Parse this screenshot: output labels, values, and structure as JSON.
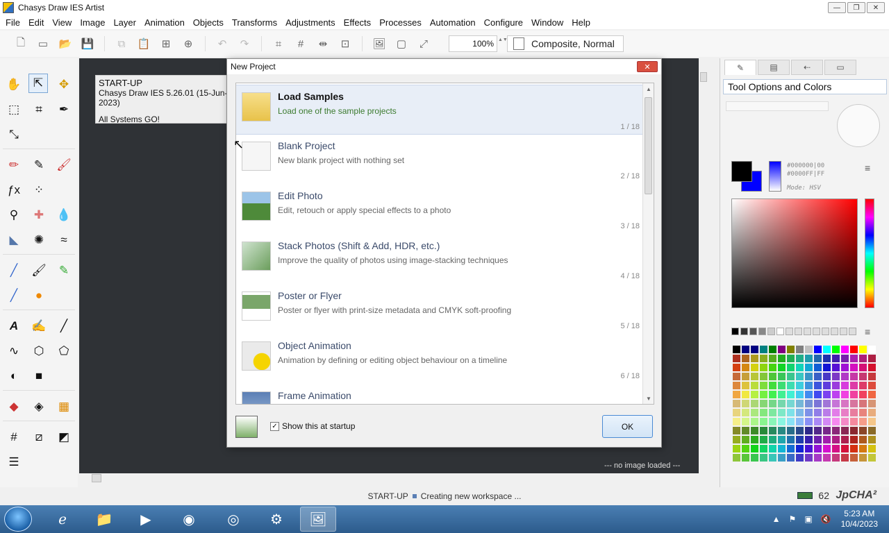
{
  "window": {
    "title": "Chasys Draw IES Artist",
    "min": "—",
    "max": "❐",
    "close": "✕"
  },
  "menu": [
    "File",
    "Edit",
    "View",
    "Image",
    "Layer",
    "Animation",
    "Objects",
    "Transforms",
    "Adjustments",
    "Effects",
    "Processes",
    "Automation",
    "Configure",
    "Window",
    "Help"
  ],
  "toolbar": {
    "zoom": "100%",
    "zoom_spin": "▲▼",
    "composite": "Composite, Normal"
  },
  "startup_card": {
    "line1": "START-UP",
    "line2": "Chasys Draw IES 5.26.01 (15-Jun-2023)",
    "line3": "All Systems GO!"
  },
  "workspace": {
    "status": "--- no image loaded ---"
  },
  "right_panel": {
    "title": "Tool Options and Colors",
    "hex1": "#000000|00",
    "hex2": "#0000FF|FF",
    "mode": "Mode: HSV",
    "menu_icon": "≡",
    "palette_colors": [
      "#000000",
      "#000080",
      "#000080",
      "#008080",
      "#008000",
      "#800080",
      "#808000",
      "#808080",
      "#c0c0c0",
      "#0000ff",
      "#00ffff",
      "#00ff00",
      "#ff00ff",
      "#ff0000",
      "#ffff00",
      "#ffffff"
    ]
  },
  "dialog": {
    "title": "New Project",
    "close": "✕",
    "items": [
      {
        "name": "Load Samples",
        "desc": "Load one of the sample projects",
        "num": "1 / 18"
      },
      {
        "name": "Blank Project",
        "desc": "New blank project with nothing set",
        "num": "2 / 18"
      },
      {
        "name": "Edit Photo",
        "desc": "Edit, retouch or apply special effects to a photo",
        "num": "3 / 18"
      },
      {
        "name": "Stack Photos (Shift & Add, HDR, etc.)",
        "desc": "Improve the quality of photos using image-stacking techniques",
        "num": "4 / 18"
      },
      {
        "name": "Poster or Flyer",
        "desc": "Poster or flyer with print-size metadata and CMYK soft-proofing",
        "num": "5 / 18"
      },
      {
        "name": "Object Animation",
        "desc": "Animation by defining or editing object behaviour on a timeline",
        "num": "6 / 18"
      },
      {
        "name": "Frame Animation",
        "desc": "",
        "num": ""
      }
    ],
    "checkbox_label": "Show this at startup",
    "checkbox_mark": "✓",
    "ok": "OK"
  },
  "status": {
    "left": "START-UP",
    "right": "Creating new workspace ...",
    "mem": "62",
    "brand": "JpCHA²"
  },
  "taskbar": {
    "time": "5:23 AM",
    "date": "10/4/2023"
  }
}
